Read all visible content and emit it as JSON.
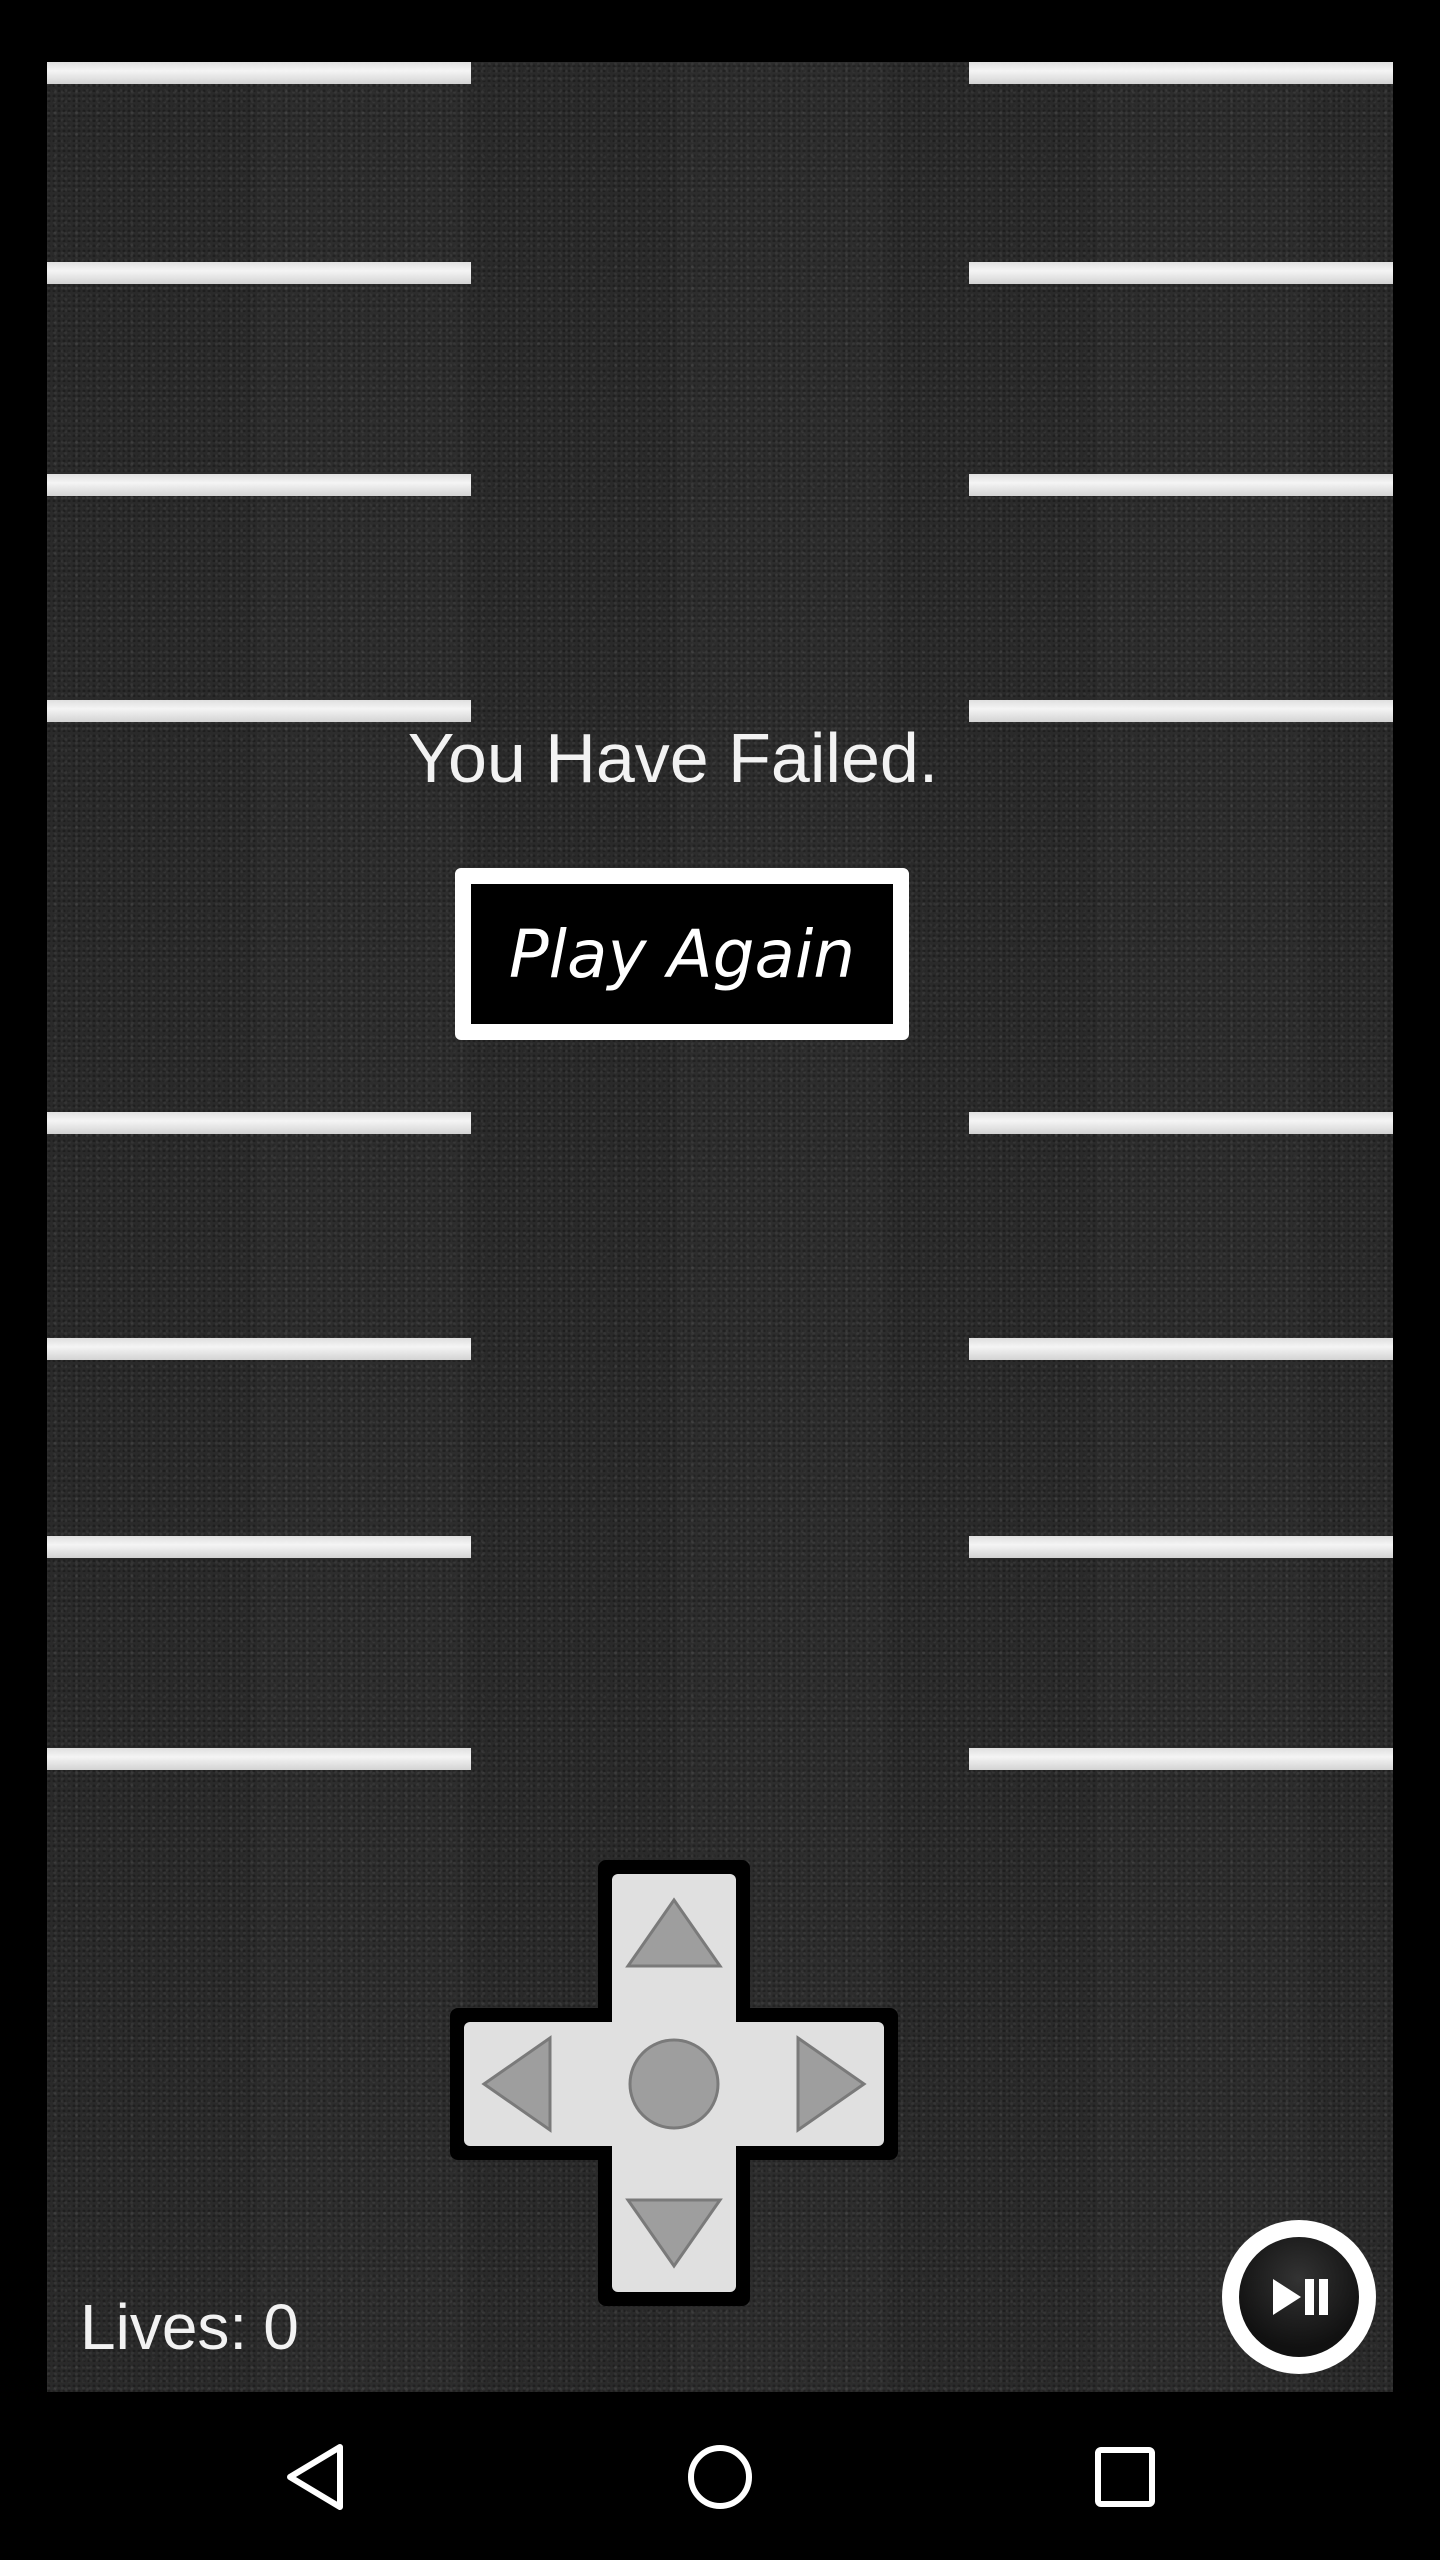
{
  "game": {
    "message": "You Have Failed.",
    "play_again_label": "Play Again",
    "lives_label": "Lives:",
    "lives_value": "0"
  },
  "controls": {
    "dpad": [
      "up-arrow-icon",
      "down-arrow-icon",
      "left-arrow-icon",
      "right-arrow-icon",
      "center-circle-icon"
    ],
    "playpause_icon": "play-pause-icon"
  },
  "navbar": {
    "items": [
      "back-icon",
      "home-icon",
      "recents-icon"
    ]
  },
  "colors": {
    "asphalt": "#2b2b2b",
    "stripe": "#ffffff",
    "dpad_fill": "#e0e0e0",
    "dpad_icon": "#9e9e9e",
    "text": "#f2f2f2"
  }
}
